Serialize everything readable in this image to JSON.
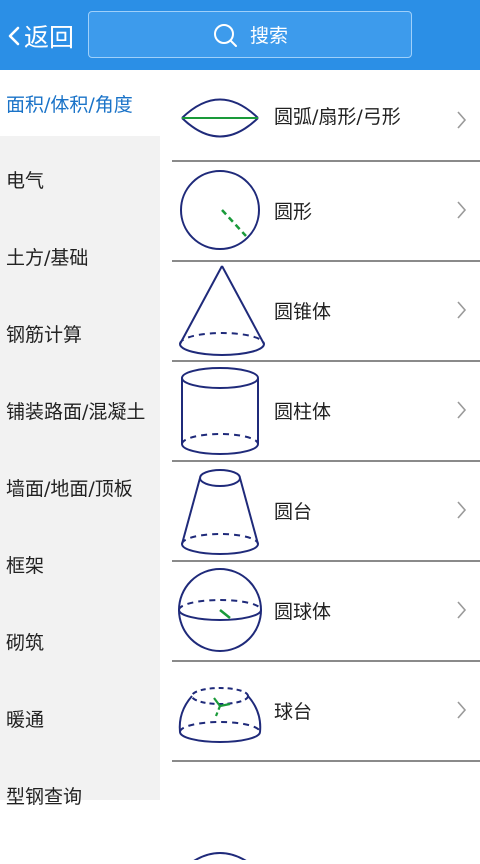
{
  "header": {
    "back_label": "返回",
    "search_placeholder": "搜索"
  },
  "sidebar": {
    "items": [
      {
        "label": "面积/体积/角度",
        "active": true
      },
      {
        "label": "电气"
      },
      {
        "label": "土方/基础"
      },
      {
        "label": "钢筋计算"
      },
      {
        "label": "铺装路面/混凝土"
      },
      {
        "label": "墙面/地面/顶板"
      },
      {
        "label": "框架"
      },
      {
        "label": "砌筑"
      },
      {
        "label": "暖通"
      },
      {
        "label": "型钢查询"
      }
    ]
  },
  "list": {
    "items": [
      {
        "label": "圆弧/扇形/弓形",
        "icon": "arc-sector-segment-icon"
      },
      {
        "label": "圆形",
        "icon": "circle-icon"
      },
      {
        "label": "圆锥体",
        "icon": "cone-icon"
      },
      {
        "label": "圆柱体",
        "icon": "cylinder-icon"
      },
      {
        "label": "圆台",
        "icon": "frustum-icon"
      },
      {
        "label": "圆球体",
        "icon": "sphere-icon"
      },
      {
        "label": "球台",
        "icon": "spherical-frustum-icon"
      }
    ]
  },
  "colors": {
    "header_bg": "#2b8fe6",
    "sidebar_bg": "#f2f2f2",
    "active_text": "#1a73c8",
    "shape_stroke": "#1f2a7a",
    "shape_accent": "#1a9a3a"
  }
}
